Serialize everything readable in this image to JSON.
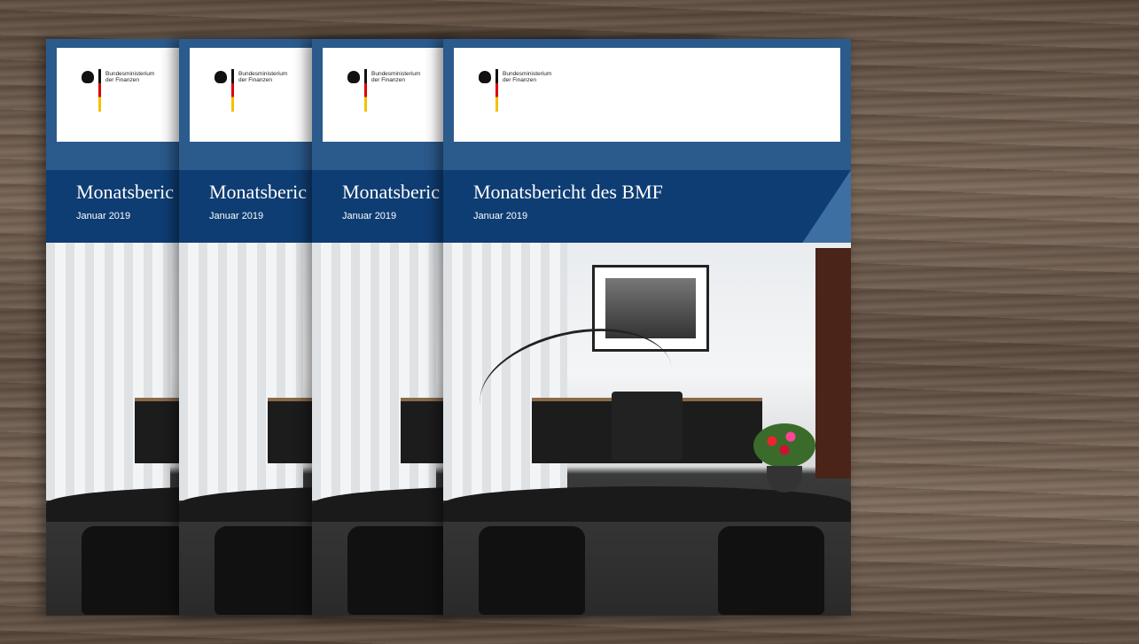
{
  "brochure": {
    "ministry_line1": "Bundesministerium",
    "ministry_line2": "der Finanzen",
    "title": "Monatsbericht des BMF",
    "title_truncated": "Monatsberic",
    "subtitle": "Januar 2019"
  },
  "colors": {
    "blue_light": "#2b5a8c",
    "blue_dark": "#0e3d73",
    "wood": "#6b5a4c"
  },
  "icons": [
    "federal-eagle-icon",
    "german-flag-bar-icon"
  ]
}
